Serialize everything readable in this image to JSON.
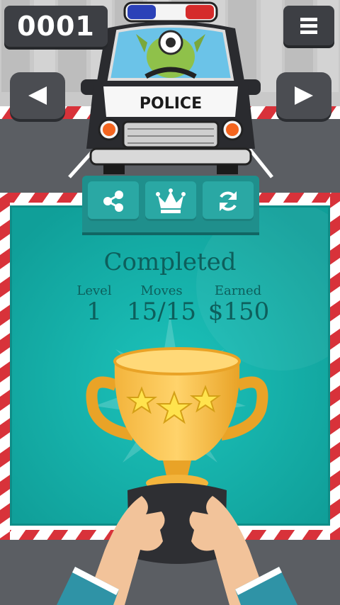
{
  "hud": {
    "counter": "0001",
    "menu_icon": "hamburger-menu-icon",
    "prev_icon": "left-arrow-icon",
    "next_icon": "right-arrow-icon"
  },
  "car": {
    "sign": "POLICE"
  },
  "actions": [
    {
      "icon": "share-icon"
    },
    {
      "icon": "crown-icon"
    },
    {
      "icon": "refresh-icon"
    }
  ],
  "result": {
    "title": "Completed",
    "stats": [
      {
        "label": "Level",
        "value": "1"
      },
      {
        "label": "Moves",
        "value": "15/15"
      },
      {
        "label": "Earned",
        "value": "$150"
      }
    ],
    "stars": 3
  },
  "colors": {
    "panel": "#14aca6",
    "panel_text": "#0d5f5c",
    "curb_red": "#d8323a",
    "button_dark": "#3d3f44"
  }
}
